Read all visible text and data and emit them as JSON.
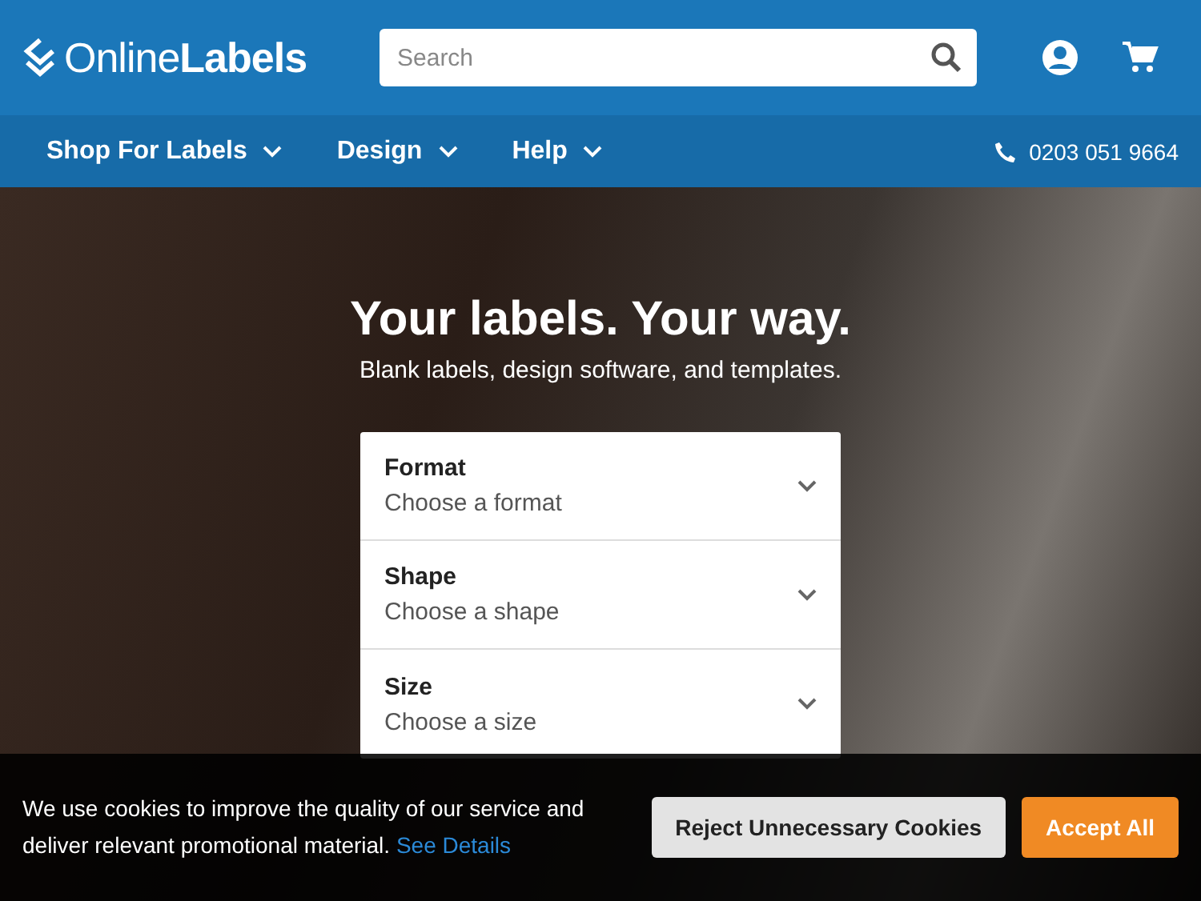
{
  "header": {
    "logo": "Online**Labels**",
    "search": {
      "placeholder": "Search"
    }
  },
  "nav": {
    "items": [
      {
        "label": "Shop For Labels"
      },
      {
        "label": "Design"
      },
      {
        "label": "Help"
      }
    ],
    "phone": "0203 051 9664"
  },
  "hero": {
    "title": "Your labels. Your way.",
    "subtitle": "Blank labels, design software, and templates."
  },
  "finder": {
    "fields": [
      {
        "label": "Format",
        "value": "Choose a format"
      },
      {
        "label": "Shape",
        "value": "Choose a shape"
      },
      {
        "label": "Size",
        "value": "Choose a size"
      }
    ]
  },
  "cookie_banner": {
    "text": "We use cookies to improve the quality of our service and deliver relevant promotional material.",
    "link": "See Details",
    "buttons": [
      {
        "label": "Reject Unnecessary Cookies",
        "kind": "secondary"
      },
      {
        "label": "Accept All",
        "kind": "primary"
      }
    ]
  }
}
